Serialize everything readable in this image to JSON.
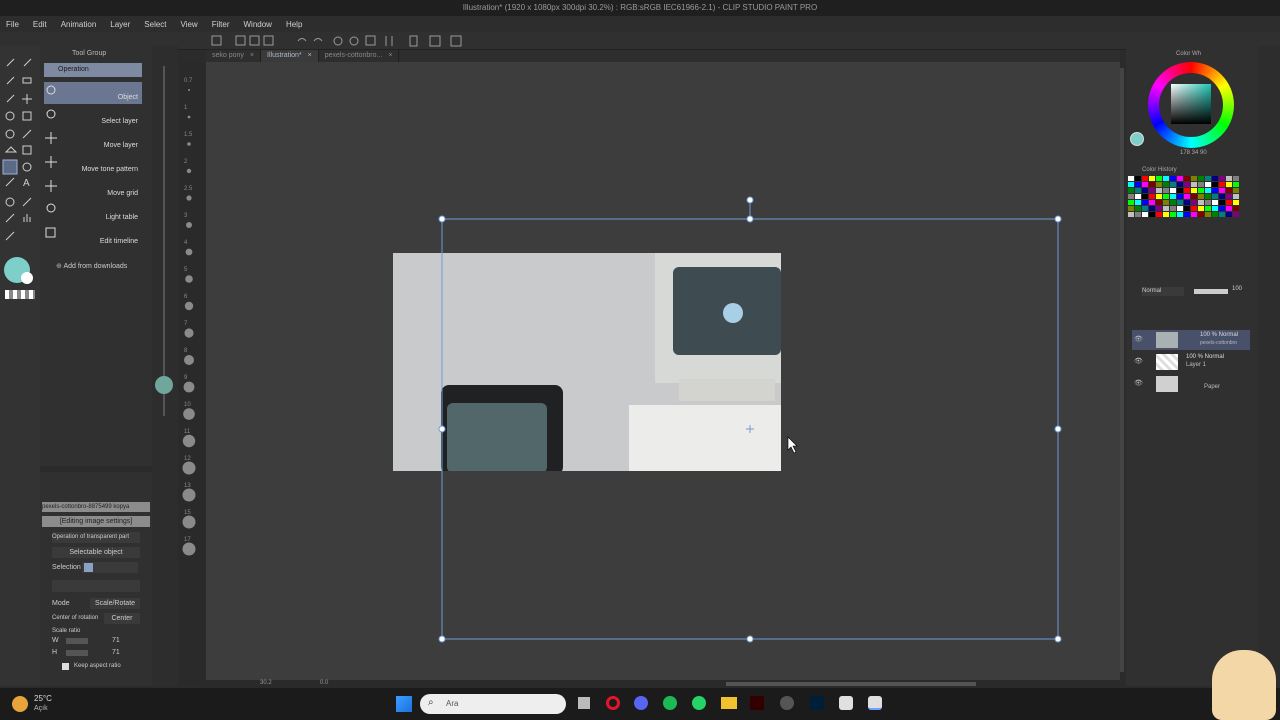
{
  "titlebar": {
    "title": "Illustration* (1920 x 1080px 300dpi 30.2%) : RGB:sRGB IEC61966-2.1) - CLIP STUDIO PAINT PRO"
  },
  "menu": [
    "File",
    "Edit",
    "Animation",
    "Layer",
    "Select",
    "View",
    "Filter",
    "Window",
    "Help"
  ],
  "tabs": [
    {
      "label": "seko pony",
      "active": false
    },
    {
      "label": "Illustration*",
      "active": true
    },
    {
      "label": "pexels-cottonbro...",
      "active": false
    }
  ],
  "subtool": {
    "group_label": "Tool Group",
    "header": "Operation",
    "items": [
      "Object",
      "Select layer",
      "Move layer",
      "Move tone pattern",
      "Move grid",
      "Light table",
      "Edit timeline"
    ],
    "add": "Add from downloads"
  },
  "toolprop": {
    "file": "pexels-cottonbro-8875499 kopya",
    "editing": "[Editing image settings]",
    "transparent": "Operation of transparent part",
    "selectable": "Selectable object",
    "selection": "Selection",
    "mode_label": "Mode",
    "mode_value": "Scale/Rotate",
    "center_label": "Center of rotation",
    "center_value": "Center",
    "scale_label": "Scale ratio",
    "w_label": "W",
    "w_value": "71",
    "h_label": "H",
    "h_value": "71",
    "keep_aspect": "Keep aspect ratio"
  },
  "ruler_ticks": [
    "0.7",
    "1",
    "1.5",
    "2",
    "2.5",
    "3",
    "4",
    "5",
    "6",
    "7",
    "8",
    "9",
    "10",
    "11",
    "12",
    "13",
    "15",
    "17"
  ],
  "canvas": {
    "zoom": "30.2",
    "angle": "0.0"
  },
  "color": {
    "readout": "178  34  90",
    "main": "#7ecfc9"
  },
  "color_history_label": "Color History",
  "color_wheel_label": "Color Wh",
  "layers": {
    "blend": "Normal",
    "opacity": "100",
    "items": [
      {
        "pct": "100 % Normal",
        "name": "pexels-cottonbro"
      },
      {
        "pct": "100 % Normal",
        "name": "Layer 1"
      },
      {
        "pct": "",
        "name": "Paper"
      }
    ]
  },
  "taskbar": {
    "temp": "25°C",
    "weather": "Açık",
    "search": "Ara"
  },
  "colors": {
    "accent": "#7e8aa2",
    "selection_line": "#6f9bd6",
    "canvas_bg": "#3d3d3d",
    "photo_wall": "#c9cacb"
  }
}
